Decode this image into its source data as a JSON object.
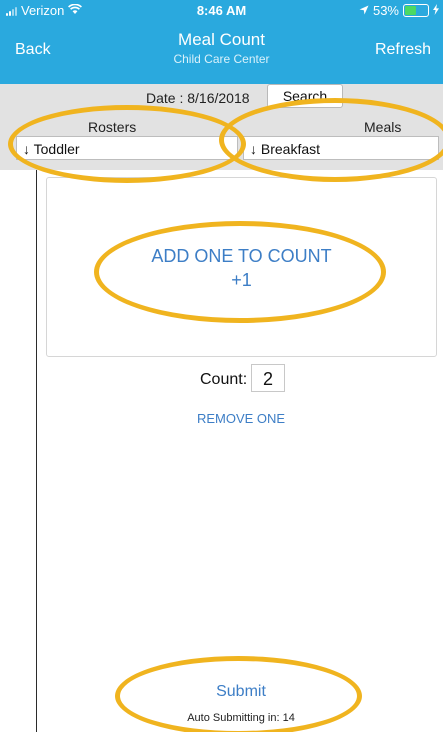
{
  "status_bar": {
    "carrier": "Verizon",
    "time": "8:46 AM",
    "battery": "53%",
    "battery_level": 0.53
  },
  "nav": {
    "back_label": "Back",
    "title": "Meal Count",
    "subtitle": "Child Care Center",
    "refresh_label": "Refresh"
  },
  "filter": {
    "date_label": "Date : 8/16/2018",
    "search_label": "Search",
    "rosters_label": "Rosters",
    "meals_label": "Meals",
    "roster_value": "↓ Toddler",
    "meal_value": "↓ Breakfast"
  },
  "main": {
    "add_label": "ADD ONE TO COUNT",
    "add_increment": "+1",
    "count_label": "Count:",
    "count_value": "2",
    "remove_label": "REMOVE ONE",
    "submit_label": "Submit",
    "auto_submit_text": "Auto Submitting in: 14"
  },
  "colors": {
    "nav_bar": "#2aa9de",
    "link": "#3d7ec6",
    "annotation": "#f0b41f"
  }
}
